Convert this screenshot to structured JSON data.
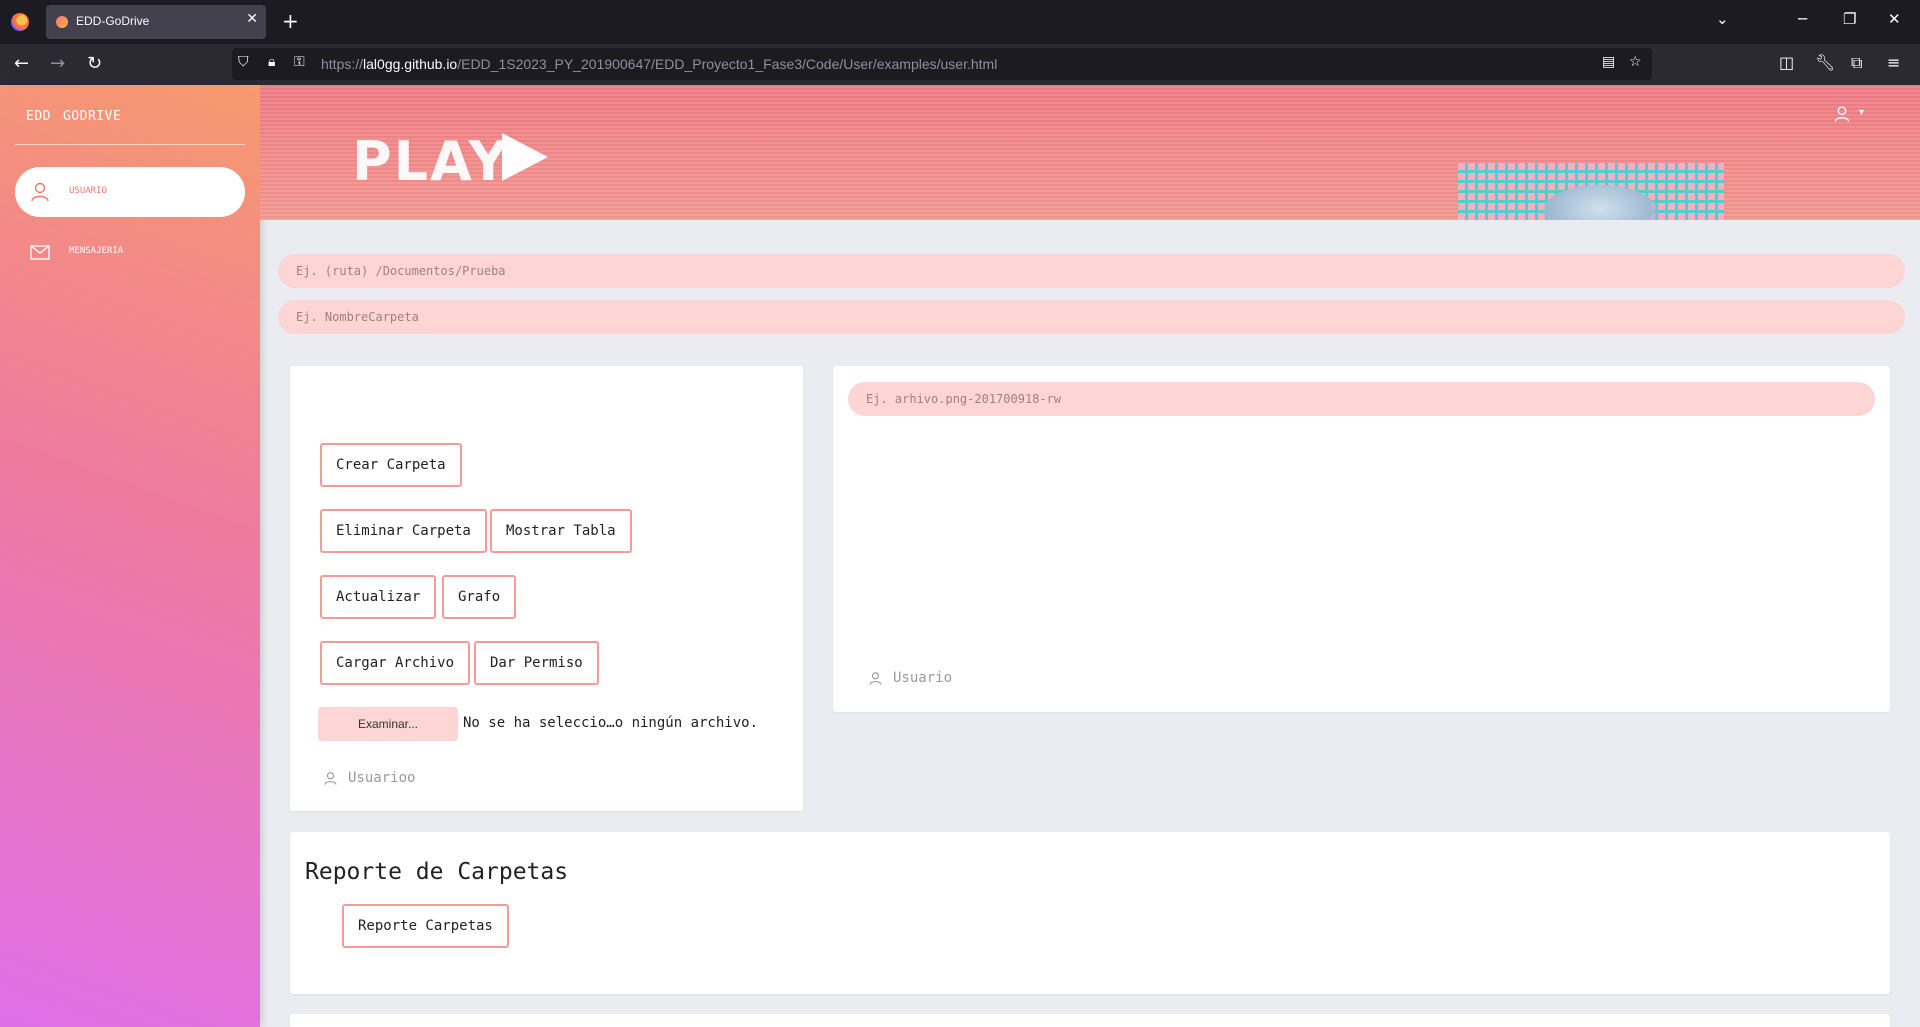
{
  "browser": {
    "tab_title": "EDD-GoDrive",
    "tab_close": "✕",
    "new_tab": "+",
    "url_prefix": "https://",
    "url_host": "lal0gg.github.io",
    "url_path": "/EDD_1S2023_PY_201900647/EDD_Proyecto1_Fase3/Code/User/examples/user.html",
    "icons": [
      "back-icon",
      "forward-icon",
      "reload-icon",
      "shield-icon",
      "lock-icon",
      "key-icon",
      "reader-icon",
      "star-icon",
      "pocket-icon",
      "wrench-icon",
      "extensions-icon",
      "menu-icon"
    ]
  },
  "sidebar": {
    "brand": [
      "EDD",
      "GODRIVE"
    ],
    "items": [
      {
        "label": "Usuario",
        "icon": "user-icon",
        "active": true
      },
      {
        "label": "Mensajeria",
        "icon": "mail-icon",
        "active": false
      }
    ]
  },
  "banner": {
    "logo_text": "PLAY"
  },
  "form": {
    "path_placeholder": "Ej. (ruta) /Documentos/Prueba",
    "folder_placeholder": "Ej. NombreCarpeta"
  },
  "actions_card": {
    "buttons": {
      "create_folder": "Crear Carpeta",
      "delete_folder": "Eliminar Carpeta",
      "show_table": "Mostrar Tabla",
      "update": "Actualizar",
      "graph": "Grafo",
      "upload_file": "Cargar Archivo",
      "give_permission": "Dar Permiso"
    },
    "file_button": "Examinar...",
    "file_status": "No se ha seleccio…o ningún archivo.",
    "footer_user": "Usuarioo"
  },
  "file_card": {
    "file_placeholder": "Ej. arhivo.png-201700918-rw",
    "footer_user": "Usuario"
  },
  "report_card": {
    "title": "Reporte de Carpetas",
    "button": "Reporte Carpetas"
  },
  "colors": {
    "accent": "#f39a9a",
    "input_bg": "#fdd5d5",
    "active_label": "#f0776e"
  }
}
